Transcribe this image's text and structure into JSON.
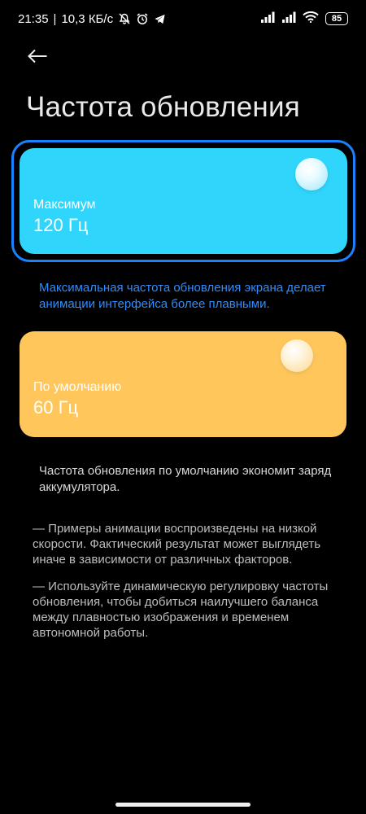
{
  "status_bar": {
    "time": "21:35",
    "separator": "|",
    "network_speed": "10,3 КБ/с",
    "battery": "85",
    "icons": [
      "mute-icon",
      "alarm-icon",
      "telegram-icon",
      "signal-icon",
      "signal-icon",
      "wifi-icon",
      "battery-icon"
    ]
  },
  "header": {
    "back_icon": "arrow-left-icon",
    "title": "Частота обновления"
  },
  "options": [
    {
      "label": "Максимум",
      "value": "120 Гц",
      "selected": true,
      "color": "#30d5fb",
      "description": "Максимальная частота обновления экрана делает анимации интерфейса более плавными."
    },
    {
      "label": "По умолчанию",
      "value": "60 Гц",
      "selected": false,
      "color": "#fec65b",
      "description": "Частота обновления по умолчанию экономит заряд аккумулятора."
    }
  ],
  "notes": [
    "— Примеры анимации воспроизведены на низкой скорости. Фактический результат может выглядеть иначе в зависимости от различных факторов.",
    "— Используйте динамическую регулировку частоты обновления, чтобы добиться наилучшего баланса между плавностью изображения и временем автономной работы."
  ],
  "colors": {
    "background": "#000000",
    "accent": "#1a82ff",
    "accent_text": "#2e8dff"
  }
}
